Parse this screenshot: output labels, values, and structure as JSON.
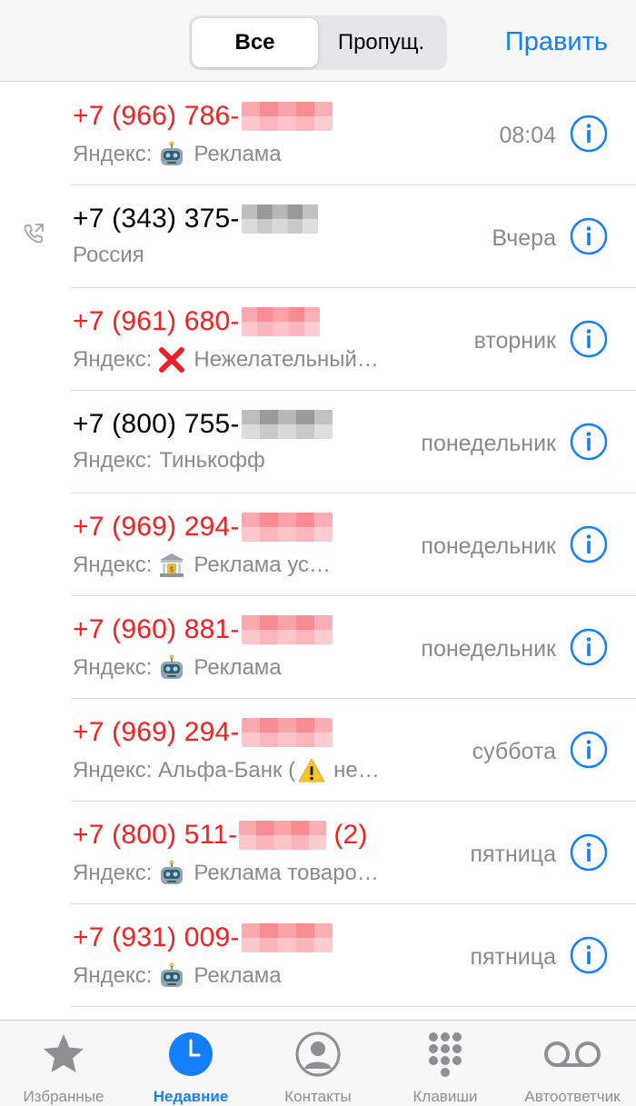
{
  "header": {
    "segments": [
      {
        "label": "Все",
        "active": true
      },
      {
        "label": "Пропущ.",
        "active": false
      }
    ],
    "edit_label": "Править"
  },
  "calls": [
    {
      "number": "+7 (966) 786-",
      "count": "",
      "missed": true,
      "outgoing": false,
      "subtitle_prefix": "Яндекс:",
      "subtitle_icon": "robot-emoji-icon",
      "subtitle_text": "Реклама",
      "time": "08:04"
    },
    {
      "number": "+7 (343) 375-",
      "count": "",
      "missed": false,
      "outgoing": true,
      "subtitle_prefix": "",
      "subtitle_icon": "",
      "subtitle_text": "Россия",
      "time": "Вчера"
    },
    {
      "number": "+7 (961) 680-",
      "count": "",
      "missed": true,
      "outgoing": false,
      "subtitle_prefix": "Яндекс:",
      "subtitle_icon": "cross-mark-emoji-icon",
      "subtitle_text": "Нежелательный…",
      "time": "вторник"
    },
    {
      "number": "+7 (800) 755-",
      "count": "",
      "missed": false,
      "outgoing": false,
      "subtitle_prefix": "Яндекс:",
      "subtitle_icon": "",
      "subtitle_text": "Тинькофф",
      "time": "понедельник"
    },
    {
      "number": "+7 (969) 294-",
      "count": "",
      "missed": true,
      "outgoing": false,
      "subtitle_prefix": "Яндекс:",
      "subtitle_icon": "bank-emoji-icon",
      "subtitle_text": "Реклама ус…",
      "time": "понедельник"
    },
    {
      "number": "+7 (960) 881-",
      "count": "",
      "missed": true,
      "outgoing": false,
      "subtitle_prefix": "Яндекс:",
      "subtitle_icon": "robot-emoji-icon",
      "subtitle_text": "Реклама",
      "time": "понедельник"
    },
    {
      "number": "+7 (969) 294-",
      "count": "",
      "missed": true,
      "outgoing": false,
      "subtitle_prefix": "Яндекс: Альфа-Банк (",
      "subtitle_icon": "warning-emoji-icon",
      "subtitle_text": "не…",
      "time": "суббота"
    },
    {
      "number": "+7 (800) 511-",
      "count": "(2)",
      "missed": true,
      "outgoing": false,
      "subtitle_prefix": "Яндекс:",
      "subtitle_icon": "robot-emoji-icon",
      "subtitle_text": "Реклама товаро…",
      "time": "пятница"
    },
    {
      "number": "+7 (931) 009-",
      "count": "",
      "missed": true,
      "outgoing": false,
      "subtitle_prefix": "Яндекс:",
      "subtitle_icon": "robot-emoji-icon",
      "subtitle_text": "Реклама",
      "time": "пятница"
    }
  ],
  "tabbar": {
    "items": [
      {
        "label": "Избранные",
        "icon": "star-icon",
        "active": false
      },
      {
        "label": "Недавние",
        "icon": "clock-icon",
        "active": true
      },
      {
        "label": "Контакты",
        "icon": "person-circle-icon",
        "active": false
      },
      {
        "label": "Клавиши",
        "icon": "keypad-icon",
        "active": false
      },
      {
        "label": "Автоответчик",
        "icon": "voicemail-icon",
        "active": false
      }
    ]
  },
  "colors": {
    "accent": "#157efb",
    "missed": "#fc1c1c",
    "secondary_text": "#8a8a8e",
    "inactive_tab": "#8e8e93"
  }
}
